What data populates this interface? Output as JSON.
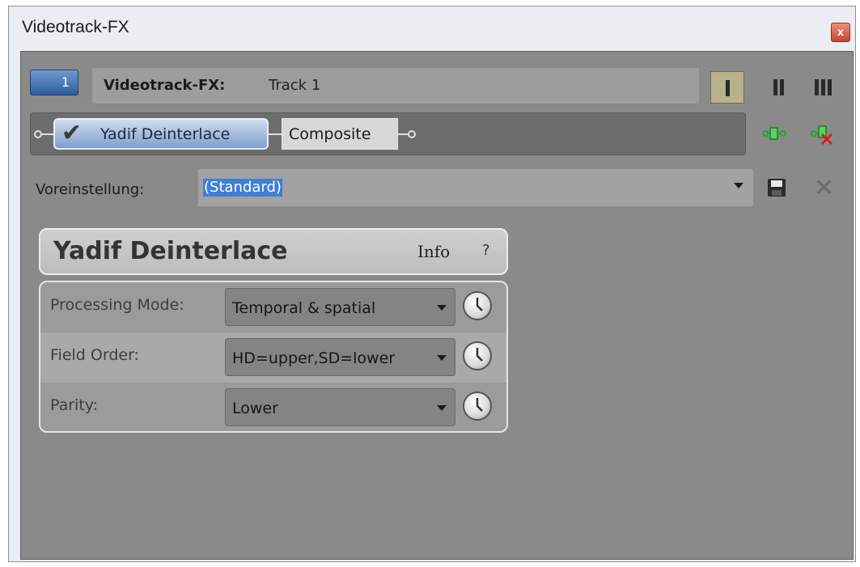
{
  "window": {
    "title": "Videotrack-FX",
    "close_label": "x"
  },
  "track": {
    "number": "1",
    "label": "Videotrack-FX:",
    "name": "Track 1"
  },
  "chain": {
    "plugins": [
      {
        "name": "Yadif Deinterlace",
        "enabled": true,
        "selected": true
      },
      {
        "name": "Composite",
        "enabled": false,
        "selected": false
      }
    ]
  },
  "preset": {
    "label": "Voreinstellung:",
    "value": "(Standard)"
  },
  "fx": {
    "title": "Yadif Deinterlace",
    "info_label": "Info",
    "help_label": "?",
    "params": [
      {
        "label": "Processing Mode:",
        "value": "Temporal & spatial"
      },
      {
        "label": "Field Order:",
        "value": "HD=upper,SD=lower"
      },
      {
        "label": "Parity:",
        "value": "Lower"
      }
    ]
  },
  "colors": {
    "accent": "#3f7fd6",
    "panel": "#8a8a8a",
    "selected_plugin": "#9fb8dd"
  },
  "icons": {
    "view_modes": [
      "single-column-view-icon",
      "two-column-view-icon",
      "three-column-view-icon"
    ],
    "chain_tools": [
      "plugin-chain-icon",
      "remove-plugin-icon"
    ],
    "preset_tools": [
      "save-icon",
      "delete-icon"
    ],
    "param_tools": [
      "keyframe-clock-icon"
    ]
  }
}
